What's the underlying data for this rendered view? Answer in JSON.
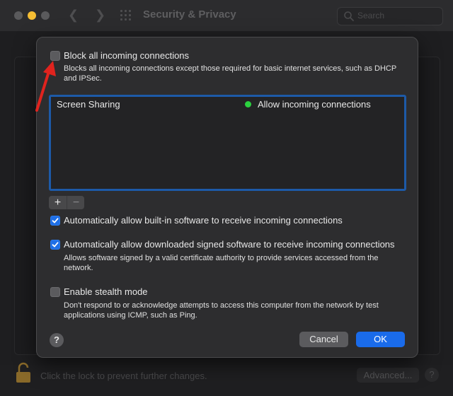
{
  "window": {
    "title": "Security & Privacy",
    "search_placeholder": "Search",
    "lock_text": "Click the lock to prevent further changes.",
    "advanced_label": "Advanced...",
    "help_label": "?"
  },
  "sheet": {
    "block_all": {
      "label": "Block all incoming connections",
      "checked": false,
      "description": "Blocks all incoming connections except those required for basic internet services, such as DHCP and IPSec."
    },
    "apps_list": [
      {
        "name": "Screen Sharing",
        "status": "Allow incoming connections",
        "status_color": "#2bd13f"
      }
    ],
    "add_label": "+",
    "remove_label": "−",
    "auto_builtin": {
      "label": "Automatically allow built-in software to receive incoming connections",
      "checked": true
    },
    "auto_signed": {
      "label": "Automatically allow downloaded signed software to receive incoming connections",
      "checked": true,
      "description": "Allows software signed by a valid certificate authority to provide services accessed from the network."
    },
    "stealth": {
      "label": "Enable stealth mode",
      "checked": false,
      "description": "Don't respond to or acknowledge attempts to access this computer from the network by test applications using ICMP, such as Ping."
    },
    "help_label": "?",
    "cancel_label": "Cancel",
    "ok_label": "OK"
  },
  "colors": {
    "accent": "#1a6bea",
    "annotation_arrow": "#e0231e",
    "allow_status": "#2bd13f"
  }
}
